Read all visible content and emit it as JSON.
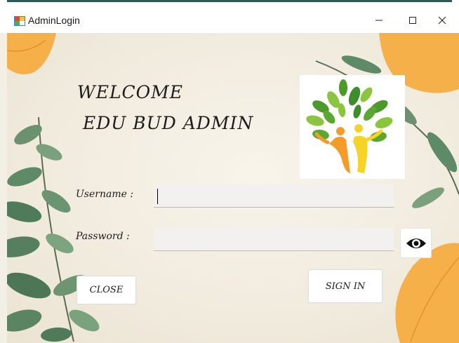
{
  "window": {
    "title": "AdminLogin",
    "minimize_icon": "minimize-icon",
    "maximize_icon": "maximize-icon",
    "close_icon": "close-icon"
  },
  "welcome": {
    "line1": "WELCOME",
    "line2": "EDU BUD ADMIN"
  },
  "logo": {
    "icon": "tree-people-logo"
  },
  "form": {
    "username_label": "Username :",
    "username_value": "",
    "password_label": "Password :",
    "password_value": "",
    "show_password_icon": "eye-icon"
  },
  "buttons": {
    "close_label": "CLOSE",
    "signin_label": "SIGN IN"
  },
  "colors": {
    "background": "#f4efe4",
    "leaf_green": "#5f8a67",
    "leaf_orange": "#f6b04a",
    "logo_green": "#8bc53f",
    "logo_orange": "#f59b2a",
    "logo_yellow": "#f5d327"
  }
}
